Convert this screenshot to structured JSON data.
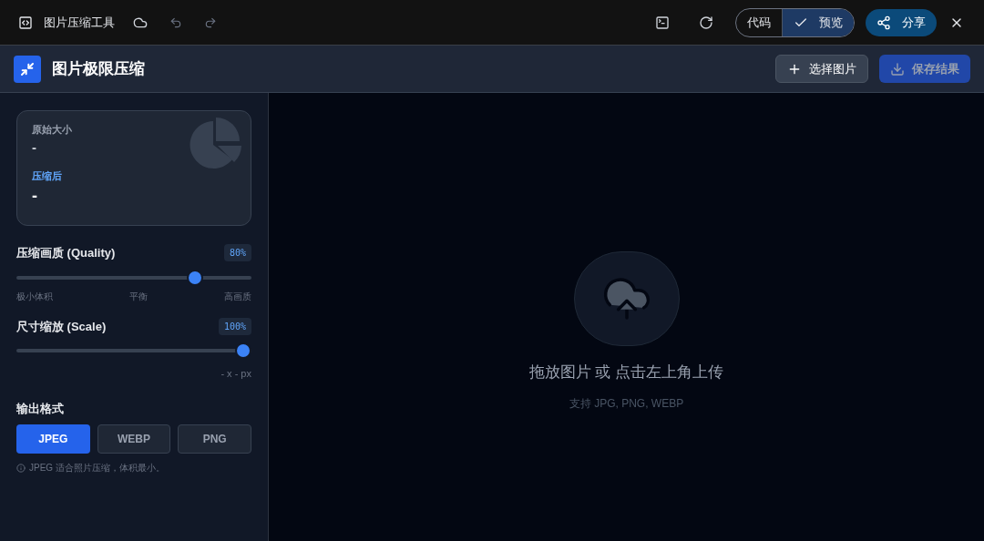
{
  "topbar": {
    "app_title": "图片压缩工具",
    "view_toggle": [
      {
        "label": "代码",
        "selected": false
      },
      {
        "label": "预览",
        "selected": true
      }
    ],
    "share": "分享"
  },
  "header": {
    "title": "图片极限压缩",
    "buttons": [
      {
        "kind": "add",
        "label": "选择图片",
        "disabled": false
      },
      {
        "kind": "save",
        "label": "保存结果",
        "disabled": true
      }
    ]
  },
  "stats": [
    {
      "kind": "original",
      "label": "原始大小",
      "value": "-"
    },
    {
      "kind": "compressed",
      "label": "压缩后",
      "value": "-"
    }
  ],
  "sliders": [
    {
      "label": "压缩画质 (Quality)",
      "badge": "80%",
      "level": 0.78,
      "ticks": [
        "极小体积",
        "平衡",
        "高画质"
      ]
    },
    {
      "label": "尺寸缩放 (Scale)",
      "badge": "100%",
      "level": 1,
      "note": "- x - px"
    }
  ],
  "format": {
    "label": "输出格式",
    "options": [
      {
        "label": "JPEG",
        "selected": true
      },
      {
        "label": "WEBP",
        "selected": false
      },
      {
        "label": "PNG",
        "selected": false
      }
    ],
    "note": "JPEG 适合照片压缩，体积最小。"
  },
  "dropzone": {
    "title": "拖放图片 或 点击左上角上传",
    "subtitle": "支持 JPG, PNG, WEBP"
  }
}
